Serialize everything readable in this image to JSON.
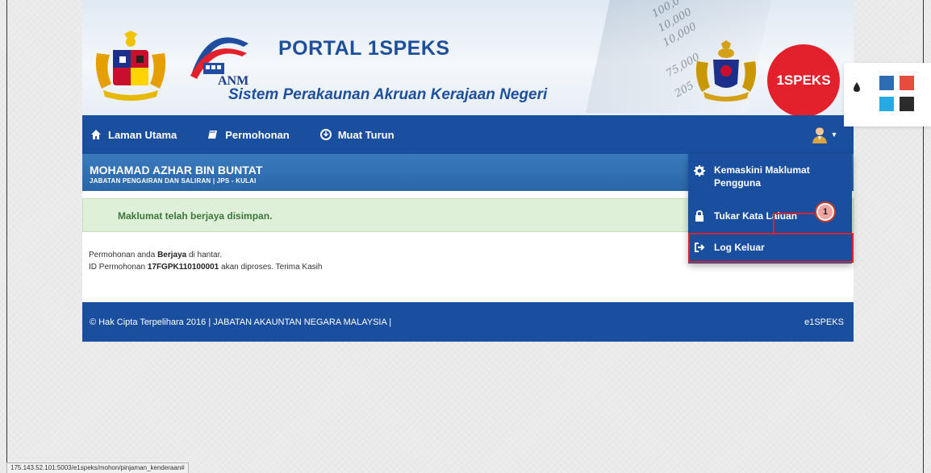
{
  "header": {
    "portal_title": "PORTAL 1SPEKS",
    "subtitle": "Sistem Perakaunan Akruan Kerajaan Negeri",
    "anm_label": "ANM",
    "speks_logo_text": "1SPEKS",
    "stock_numbers": [
      "100,0",
      "10,000",
      "10,000",
      "75,000",
      "205"
    ]
  },
  "nav": {
    "items": [
      {
        "label": "Laman Utama",
        "icon": "home-icon"
      },
      {
        "label": "Permohonan",
        "icon": "book-icon"
      },
      {
        "label": "Muat Turun",
        "icon": "download-circle-icon"
      }
    ],
    "user_icon": "user-avatar-icon"
  },
  "user": {
    "name": "MOHAMAD AZHAR BIN BUNTAT",
    "department": "JABATAN PENGAIRAN DAN SALIRAN | JPS - KULAI"
  },
  "alert": {
    "text": "Maklumat telah berjaya disimpan."
  },
  "message": {
    "line1_prefix": "Permohonan anda ",
    "line1_bold": "Berjaya",
    "line1_suffix": " di hantar.",
    "line2_prefix": "ID Permohonan ",
    "line2_bold": "17FGPK110100001",
    "line2_suffix": " akan diproses. Terima Kasih"
  },
  "footer": {
    "copyright": "© Hak Cipta Terpelihara 2016 | JABATAN AKAUNTAN NEGARA MALAYSIA |",
    "brand": "e1SPEKS"
  },
  "dropdown": {
    "edit_profile_line1": "Kemaskini Maklumat",
    "edit_profile_line2": "Pengguna",
    "change_password": "Tukar Kata Laluan",
    "logout": "Log Keluar"
  },
  "callout": {
    "number": "1",
    "color": "#d9232e"
  },
  "theme": {
    "icon": "color-drop-icon",
    "swatches": [
      "#2f6db3",
      "#e84c3d",
      "#27a9e1",
      "#2b2b2b"
    ]
  },
  "status_bar": {
    "url": "175.143.52.101:5003/e1speks/mohon/pinjaman_kenderaan#"
  }
}
